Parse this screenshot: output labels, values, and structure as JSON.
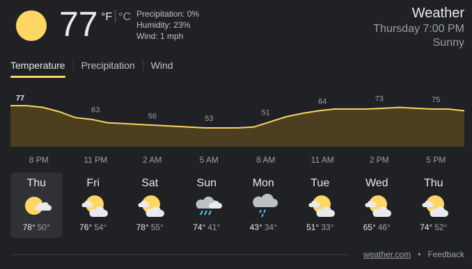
{
  "current": {
    "temperature": "77",
    "unit_f": "°F",
    "unit_c": "°C",
    "precipitation": "Precipitation: 0%",
    "humidity": "Humidity: 23%",
    "wind": "Wind: 1 mph",
    "icon": "sun-icon"
  },
  "header": {
    "title": "Weather",
    "datetime": "Thursday 7:00 PM",
    "condition": "Sunny"
  },
  "tabs": [
    {
      "label": "Temperature",
      "active": true
    },
    {
      "label": "Precipitation",
      "active": false
    },
    {
      "label": "Wind",
      "active": false
    }
  ],
  "chart_data": {
    "type": "area",
    "title": "",
    "xlabel": "",
    "ylabel": "",
    "x": [
      "8 PM",
      "11 PM",
      "2 AM",
      "5 AM",
      "8 AM",
      "11 AM",
      "2 PM",
      "5 PM"
    ],
    "values": [
      77,
      63,
      56,
      53,
      51,
      64,
      73,
      75
    ],
    "curve": [
      77,
      77,
      75,
      70,
      63,
      61,
      57,
      56,
      55,
      54,
      53,
      52,
      51,
      51,
      51,
      52,
      58,
      64,
      68,
      71,
      73,
      73,
      73,
      74,
      75,
      74,
      73,
      73,
      71
    ],
    "line_color": "#fdd663",
    "fill_color": "#4b3f1f",
    "grid": false
  },
  "forecast": [
    {
      "day": "Thu",
      "hi": "78°",
      "lo": "50°",
      "icon": "partly-cloudy-icon",
      "selected": true
    },
    {
      "day": "Fri",
      "hi": "76°",
      "lo": "54°",
      "icon": "partly-cloudy-icon",
      "selected": false
    },
    {
      "day": "Sat",
      "hi": "78°",
      "lo": "55°",
      "icon": "partly-cloudy-icon",
      "selected": false
    },
    {
      "day": "Sun",
      "hi": "74°",
      "lo": "41°",
      "icon": "thunderstorm-icon",
      "selected": false
    },
    {
      "day": "Mon",
      "hi": "43°",
      "lo": "34°",
      "icon": "rain-icon",
      "selected": false
    },
    {
      "day": "Tue",
      "hi": "51°",
      "lo": "33°",
      "icon": "partly-cloudy-icon",
      "selected": false
    },
    {
      "day": "Wed",
      "hi": "65°",
      "lo": "46°",
      "icon": "partly-cloudy-icon",
      "selected": false
    },
    {
      "day": "Thu",
      "hi": "74°",
      "lo": "52°",
      "icon": "partly-cloudy-icon",
      "selected": false
    }
  ],
  "footer": {
    "source": "weather.com",
    "separator": "•",
    "feedback": "Feedback"
  }
}
